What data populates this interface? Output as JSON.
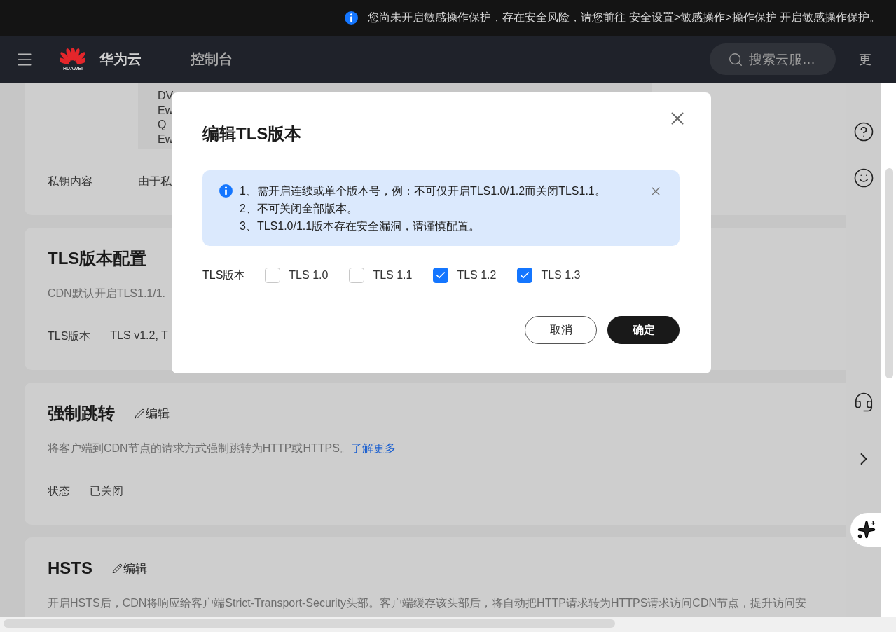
{
  "notice": {
    "text": "您尚未开启敏感操作保护，存在安全风险，请您前往 安全设置>敏感操作>操作保护 开启敏感操作保护。"
  },
  "header": {
    "logo_text": "HUAWEI",
    "brand": "华为云",
    "console": "控制台",
    "search": {
      "placeholder": "搜索云服…"
    },
    "more": "更"
  },
  "sections": [
    {
      "rows": [
        {
          "lines": [
            "DV",
            "Ew",
            "Q",
            "Ew"
          ]
        },
        {
          "label": "私钥内容",
          "value": "由于私"
        }
      ]
    },
    {
      "title": "TLS版本配置",
      "description": {
        "text": "CDN默认开启TLS1.1/1."
      },
      "rows": [
        {
          "label": "TLS版本",
          "value": "TLS v1.2, T"
        }
      ]
    },
    {
      "title": "强制跳转",
      "edit": "编辑",
      "description": {
        "text": "将客户端到CDN节点的请求方式强制跳转为HTTP或HTTPS。",
        "link": "了解更多"
      },
      "rows": [
        {
          "label": "状态",
          "value": "已关闭"
        }
      ]
    },
    {
      "title": "HSTS",
      "edit": "编辑",
      "description": {
        "text": "开启HSTS后，CDN将响应给客户端Strict-Transport-Security头部。客户端缓存该头部后，将自动把HTTP请求转为HTTPS请求访问CDN节点，提升访问安"
      }
    }
  ],
  "dialog": {
    "title": "编辑TLS版本",
    "alert": [
      "1、需开启连续或单个版本号，例：不可仅开启TLS1.0/1.2而关闭TLS1.1。",
      "2、不可关闭全部版本。",
      "3、TLS1.0/1.1版本存在安全漏洞，请谨慎配置。"
    ],
    "field_label": "TLS版本",
    "options": [
      {
        "label": "TLS 1.0",
        "checked": false
      },
      {
        "label": "TLS 1.1",
        "checked": false
      },
      {
        "label": "TLS 1.2",
        "checked": true
      },
      {
        "label": "TLS 1.3",
        "checked": true
      }
    ],
    "buttons": [
      {
        "label": "取消",
        "kind": "secondary"
      },
      {
        "label": "确定",
        "kind": "primary"
      }
    ]
  }
}
